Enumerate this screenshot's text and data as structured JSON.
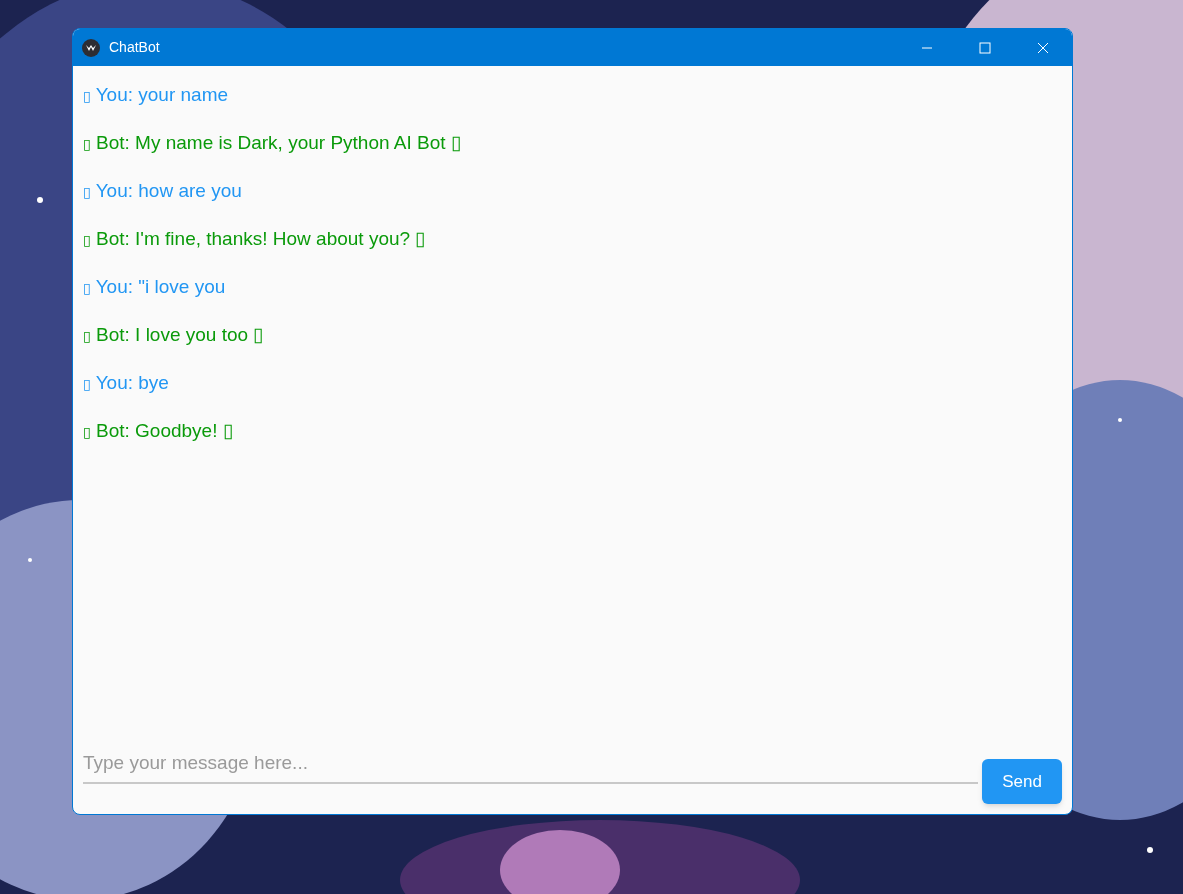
{
  "window": {
    "title": "ChatBot"
  },
  "messages": [
    {
      "kind": "user",
      "text": "▯ You: your name"
    },
    {
      "kind": "bot",
      "text": "▯ Bot: My name is Dark, your Python AI Bot ▯"
    },
    {
      "kind": "user",
      "text": "▯ You: how are you"
    },
    {
      "kind": "bot",
      "text": "▯ Bot: I'm fine, thanks! How about you? ▯"
    },
    {
      "kind": "user",
      "text": "▯ You: \"i love you"
    },
    {
      "kind": "bot",
      "text": "▯ Bot: I love you too ▯"
    },
    {
      "kind": "user",
      "text": "▯ You: bye"
    },
    {
      "kind": "bot",
      "text": "▯ Bot: Goodbye! ▯"
    }
  ],
  "input": {
    "placeholder": "Type your message here..."
  },
  "send_button": {
    "label": "Send"
  }
}
